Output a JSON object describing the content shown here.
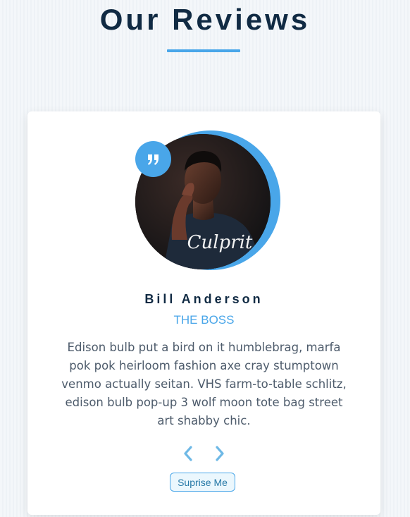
{
  "header": {
    "title": "Our Reviews"
  },
  "review": {
    "image_alt": "portrait-photo",
    "quote_icon": "quote-right-icon",
    "author": "Bill Anderson",
    "job": "THE BOSS",
    "info": "Edison bulb put a bird on it humblebrag, marfa pok pok heirloom fashion axe cray stumptown venmo actually seitan. VHS farm-to-table schlitz, edison bulb pop-up 3 wolf moon tote bag street art shabby chic.",
    "shirt_text": "Culprit"
  },
  "controls": {
    "prev_icon": "chevron-left-icon",
    "next_icon": "chevron-right-icon",
    "random_label": "Suprise Me"
  },
  "colors": {
    "accent": "#49a6e9",
    "title": "#102a43",
    "text": "#4d5b6b",
    "card": "#ffffff"
  }
}
